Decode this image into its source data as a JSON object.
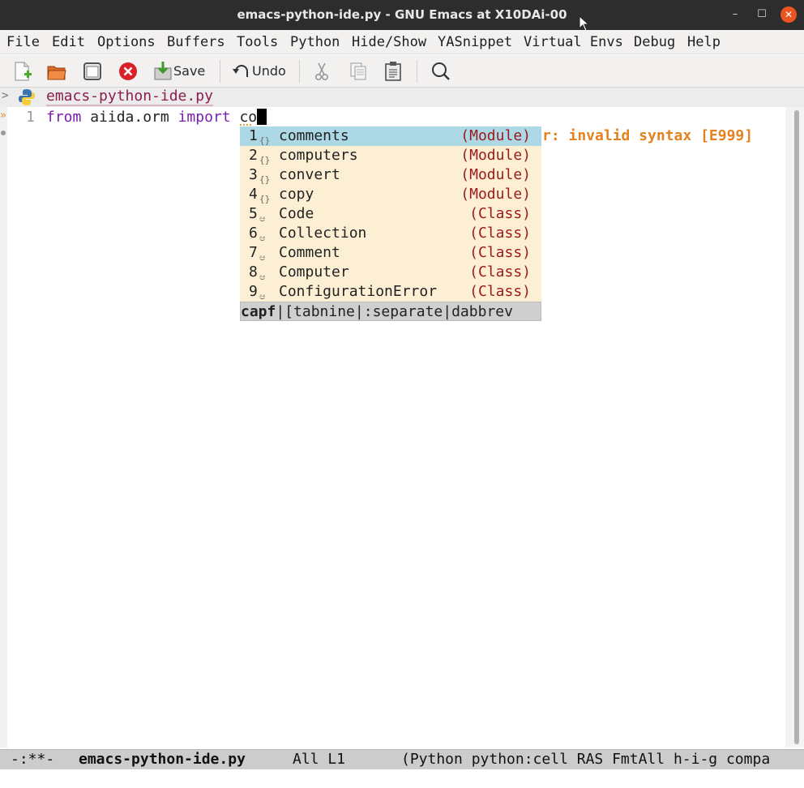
{
  "window": {
    "title": "emacs-python-ide.py - GNU Emacs at X10DAi-00"
  },
  "menu": [
    "File",
    "Edit",
    "Options",
    "Buffers",
    "Tools",
    "Python",
    "Hide/Show",
    "YASnippet",
    "Virtual Envs",
    "Debug",
    "Help"
  ],
  "toolbar": {
    "save_label": "Save",
    "undo_label": "Undo"
  },
  "header": {
    "chevron": ">",
    "filename": "emacs-python-ide.py"
  },
  "editor": {
    "line_number": "1",
    "code": {
      "kw1": "from",
      "module": "aiida.orm",
      "kw2": "import",
      "typed": "co"
    },
    "flycheck_message": "r: invalid syntax [E999]"
  },
  "completion": {
    "candidates": [
      {
        "num": "1",
        "icon": "{}",
        "label": "comments",
        "annotation": "(Module)",
        "selected": true
      },
      {
        "num": "2",
        "icon": "{}",
        "label": "computers",
        "annotation": "(Module)"
      },
      {
        "num": "3",
        "icon": "{}",
        "label": "convert",
        "annotation": "(Module)"
      },
      {
        "num": "4",
        "icon": "{}",
        "label": "copy",
        "annotation": "(Module)"
      },
      {
        "num": "5",
        "icon": "ಆ",
        "label": "Code",
        "annotation": "(Class)"
      },
      {
        "num": "6",
        "icon": "ಆ",
        "label": "Collection",
        "annotation": "(Class)"
      },
      {
        "num": "7",
        "icon": "ಆ",
        "label": "Comment",
        "annotation": "(Class)"
      },
      {
        "num": "8",
        "icon": "ಆ",
        "label": "Computer",
        "annotation": "(Class)"
      },
      {
        "num": "9",
        "icon": "ಆ",
        "label": "ConfigurationError",
        "annotation": "(Class)"
      }
    ],
    "footer_active": "capf",
    "footer_rest": "|[tabnine|:separate|dabbrev"
  },
  "modeline": {
    "state": "-:**-",
    "buffer": "emacs-python-ide.py",
    "position": "All L1",
    "modes": "(Python python:cell RAS FmtAll h-i-g compa"
  }
}
